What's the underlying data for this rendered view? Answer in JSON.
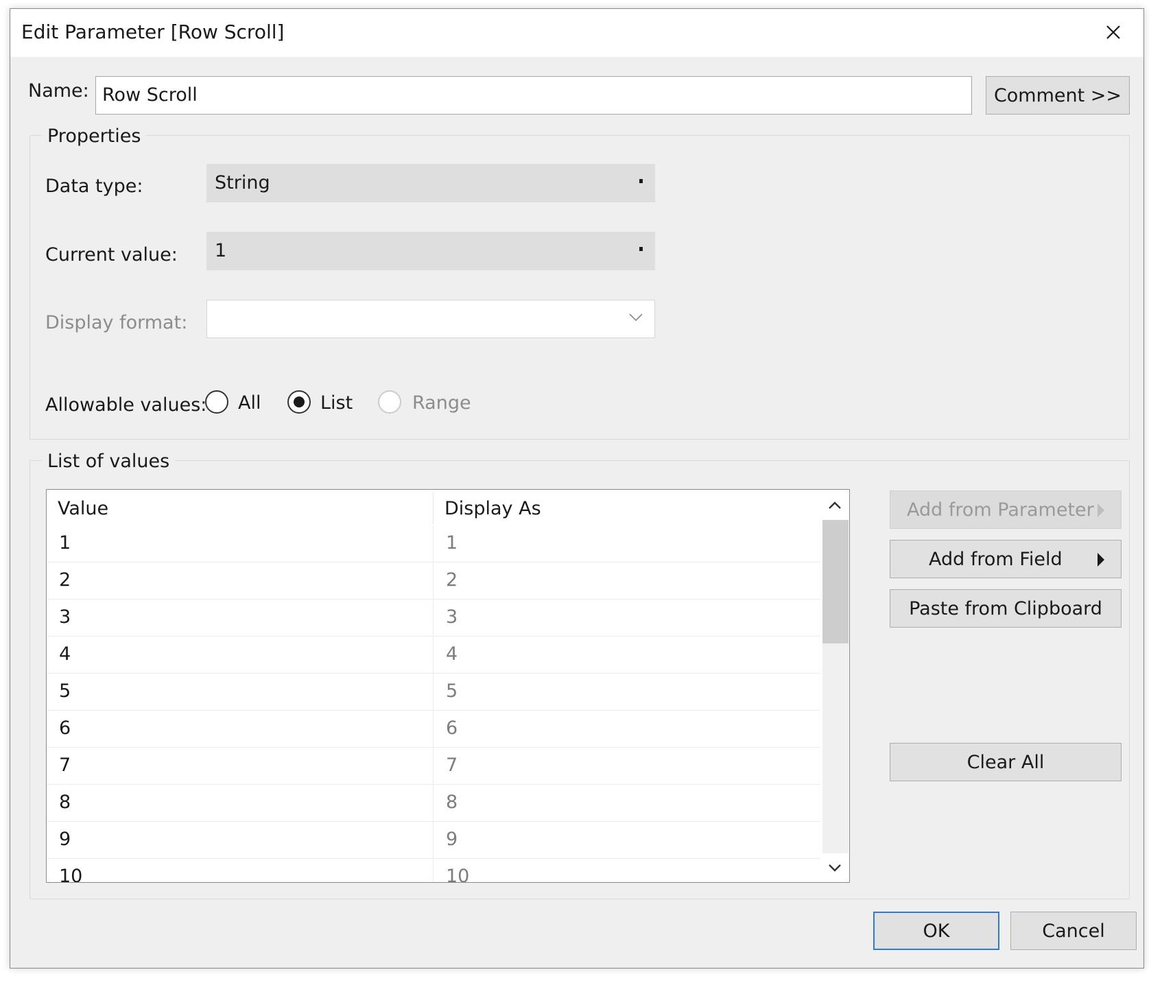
{
  "window": {
    "title": "Edit Parameter [Row Scroll]"
  },
  "name": {
    "label": "Name:",
    "value": "Row Scroll"
  },
  "comment_button": "Comment >>",
  "properties": {
    "title": "Properties",
    "data_type": {
      "label": "Data type:",
      "value": "String"
    },
    "current_value": {
      "label": "Current value:",
      "value": "1"
    },
    "display_format": {
      "label": "Display format:",
      "value": ""
    },
    "allowable_values": {
      "label": "Allowable values:",
      "options": [
        "All",
        "List",
        "Range"
      ],
      "selected": "List"
    }
  },
  "list_of_values": {
    "title": "List of values",
    "columns": [
      "Value",
      "Display As"
    ],
    "rows": [
      [
        "1",
        "1"
      ],
      [
        "2",
        "2"
      ],
      [
        "3",
        "3"
      ],
      [
        "4",
        "4"
      ],
      [
        "5",
        "5"
      ],
      [
        "6",
        "6"
      ],
      [
        "7",
        "7"
      ],
      [
        "8",
        "8"
      ],
      [
        "9",
        "9"
      ],
      [
        "10",
        "10"
      ]
    ]
  },
  "side_buttons": {
    "add_from_parameter": "Add from Parameter",
    "add_from_field": "Add from Field",
    "paste_from_clipboard": "Paste from Clipboard",
    "clear_all": "Clear All"
  },
  "footer": {
    "ok": "OK",
    "cancel": "Cancel"
  }
}
